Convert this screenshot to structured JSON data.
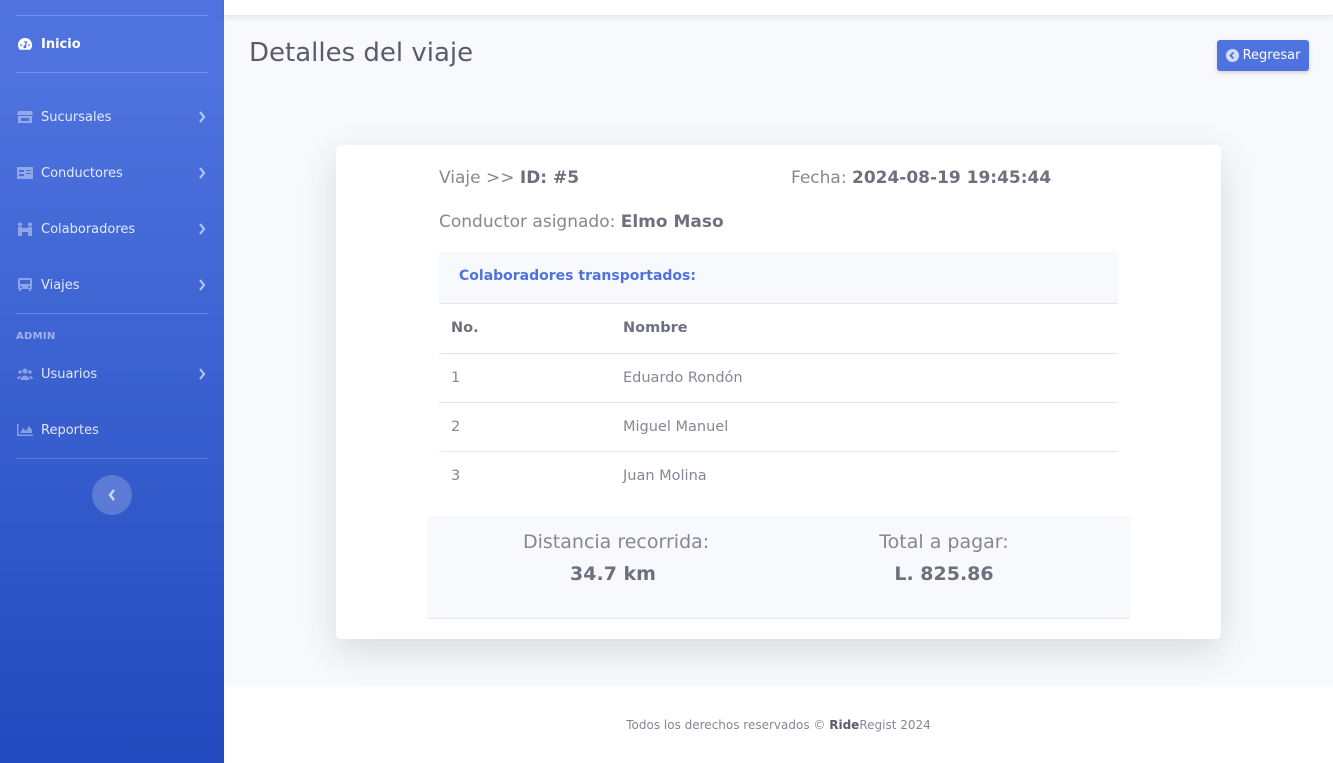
{
  "sidebar": {
    "items": [
      {
        "label": "Inicio",
        "icon": "tachometer-icon"
      },
      {
        "label": "Sucursales",
        "icon": "store-icon"
      },
      {
        "label": "Conductores",
        "icon": "id-card-icon"
      },
      {
        "label": "Colaboradores",
        "icon": "people-carry-icon"
      },
      {
        "label": "Viajes",
        "icon": "bus-icon"
      },
      {
        "label": "Usuarios",
        "icon": "users-icon"
      },
      {
        "label": "Reportes",
        "icon": "chart-area-icon"
      }
    ],
    "admin_heading": "ADMIN"
  },
  "header": {
    "title": "Detalles del viaje",
    "back_button": "Regresar"
  },
  "trip": {
    "viaje_label": "Viaje >> ",
    "id_label": "ID: #5",
    "fecha_label": "Fecha: ",
    "fecha_value": "2024-08-19 19:45:44",
    "conductor_label": "Conductor asignado: ",
    "conductor_value": "Elmo Maso"
  },
  "collaborators": {
    "heading": "Colaboradores transportados:",
    "columns": [
      "No.",
      "Nombre"
    ],
    "rows": [
      [
        "1",
        "Eduardo Rondón"
      ],
      [
        "2",
        "Miguel Manuel"
      ],
      [
        "3",
        "Juan Molina"
      ]
    ]
  },
  "summary": {
    "distance_label": "Distancia recorrida:",
    "distance_value": "34.7 km",
    "total_label": "Total a pagar:",
    "total_value": "L. 825.86"
  },
  "footer": {
    "prefix": "Todos los derechos reservados © ",
    "brand_bold": "Ride",
    "brand_rest": "Regist 2024"
  },
  "colors": {
    "primary": "#4e73df",
    "sidebar_gradient_end": "#224abe"
  }
}
